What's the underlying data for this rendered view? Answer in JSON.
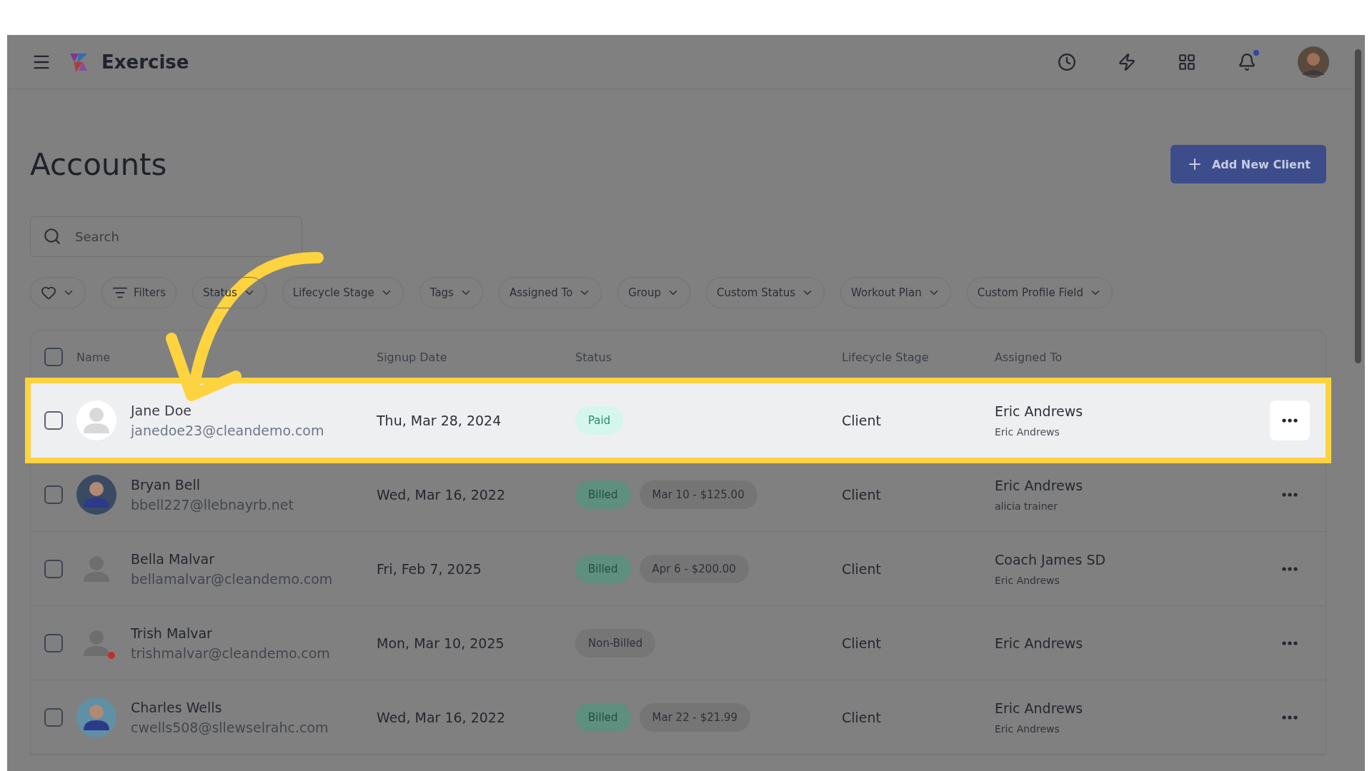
{
  "app": {
    "name": "Exercise"
  },
  "page": {
    "title": "Accounts",
    "primary_action": "Add New Client"
  },
  "search": {
    "placeholder": "Search"
  },
  "filters": [
    {
      "kind": "favorite"
    },
    {
      "kind": "filters",
      "label": "Filters"
    },
    {
      "kind": "dropdown",
      "label": "Status"
    },
    {
      "kind": "dropdown",
      "label": "Lifecycle Stage"
    },
    {
      "kind": "dropdown",
      "label": "Tags"
    },
    {
      "kind": "dropdown",
      "label": "Assigned To"
    },
    {
      "kind": "dropdown",
      "label": "Group"
    },
    {
      "kind": "dropdown",
      "label": "Custom Status"
    },
    {
      "kind": "dropdown",
      "label": "Workout Plan"
    },
    {
      "kind": "dropdown",
      "label": "Custom Profile Field"
    }
  ],
  "table": {
    "columns": [
      "Name",
      "Signup Date",
      "Status",
      "Lifecycle Stage",
      "Assigned To"
    ],
    "select_all_checked": false,
    "rows": [
      {
        "selected": true,
        "checked": false,
        "avatar": {
          "kind": "placeholder"
        },
        "alert": false,
        "name": "Jane Doe",
        "email": "janedoe23@cleandemo.com",
        "signup_date": "Thu, Mar 28, 2024",
        "status": {
          "kind": "paid",
          "label": "Paid"
        },
        "lifecycle": "Client",
        "assigned_to": "Eric Andrews",
        "assigned_sub": "Eric Andrews"
      },
      {
        "selected": false,
        "checked": false,
        "avatar": {
          "kind": "photo"
        },
        "alert": false,
        "name": "Bryan Bell",
        "email": "bbell227@llebnayrb.net",
        "signup_date": "Wed, Mar 16, 2022",
        "status": {
          "kind": "billed",
          "label": "Billed"
        },
        "billing": "Mar 10 - $125.00",
        "lifecycle": "Client",
        "assigned_to": "Eric Andrews",
        "assigned_sub": "alicia trainer"
      },
      {
        "selected": false,
        "checked": false,
        "avatar": {
          "kind": "placeholder"
        },
        "alert": false,
        "name": "Bella Malvar",
        "email": "bellamalvar@cleandemo.com",
        "signup_date": "Fri, Feb 7, 2025",
        "status": {
          "kind": "billed",
          "label": "Billed"
        },
        "billing": "Apr 6 - $200.00",
        "lifecycle": "Client",
        "assigned_to": "Coach James SD",
        "assigned_sub": "Eric Andrews"
      },
      {
        "selected": false,
        "checked": false,
        "avatar": {
          "kind": "placeholder"
        },
        "alert": true,
        "name": "Trish Malvar",
        "email": "trishmalvar@cleandemo.com",
        "signup_date": "Mon, Mar 10, 2025",
        "status": {
          "kind": "nonbilled",
          "label": "Non-Billed"
        },
        "lifecycle": "Client",
        "assigned_to": "Eric Andrews"
      },
      {
        "selected": false,
        "checked": false,
        "avatar": {
          "kind": "photo2"
        },
        "alert": false,
        "name": "Charles Wells",
        "email": "cwells508@sllewselrahc.com",
        "signup_date": "Wed, Mar 16, 2022",
        "status": {
          "kind": "billed",
          "label": "Billed"
        },
        "billing": "Mar 22 - $21.99",
        "lifecycle": "Client",
        "assigned_to": "Eric Andrews",
        "assigned_sub": "Eric Andrews"
      }
    ]
  },
  "notifications": {
    "unread": true
  }
}
